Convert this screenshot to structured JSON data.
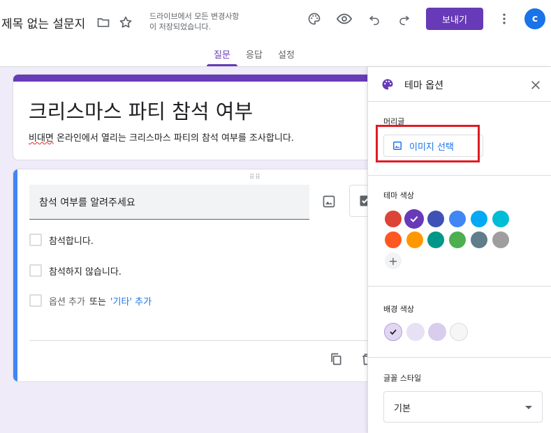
{
  "header": {
    "doc_title": "제목 없는 설문지",
    "save_status_line1": "드라이브에서 모든 변경사항",
    "save_status_line2": "이 저장되었습니다.",
    "send_label": "보내기",
    "avatar_initial": "c"
  },
  "tabs": [
    {
      "label": "질문",
      "active": true
    },
    {
      "label": "응답",
      "active": false
    },
    {
      "label": "설정",
      "active": false
    }
  ],
  "form": {
    "title": "크리스마스 파티 참석 여부",
    "description_misspelled": "비대면",
    "description_rest": " 온라인에서 열리는 크리스마스 파티의 참석 여부를 조사합니다."
  },
  "question": {
    "title": "참석 여부를 알려주세요",
    "options": [
      "참석합니다.",
      "참석하지 않습니다."
    ],
    "add_option": "옵션 추가",
    "add_or": "또는",
    "add_other": "'기타' 추가"
  },
  "theme_panel": {
    "title": "테마 옵션",
    "header_section_label": "머리글",
    "choose_image_label": "이미지 선택",
    "theme_color_label": "테마 색상",
    "theme_colors": [
      "#db4437",
      "#673ab7",
      "#3f51b5",
      "#4285f4",
      "#03a9f4",
      "#00bcd4",
      "#ff5722",
      "#ff9800",
      "#009688",
      "#4caf50",
      "#607d8b",
      "#9e9e9e"
    ],
    "selected_theme_color": "#673ab7",
    "bg_color_label": "배경 색상",
    "bg_colors": [
      "#e1d7f2",
      "#e8e1f5",
      "#d9cdee",
      "#f6f6f6"
    ],
    "selected_bg_index": 0,
    "font_style_label": "글꼴 스타일",
    "font_style_value": "기본"
  }
}
